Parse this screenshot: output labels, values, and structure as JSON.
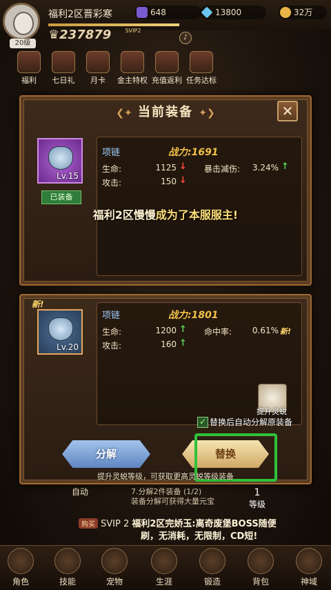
{
  "header": {
    "server_name": "福利2区晋彩寒",
    "level_badge": "20级",
    "power_value": "237879",
    "svip_label": "SVIP2",
    "currency_1": "648",
    "currency_2": "13800",
    "currency_3": "32万"
  },
  "menu": [
    "福利",
    "七日礼",
    "月卡",
    "金主特权",
    "充值返利",
    "任务达标"
  ],
  "dialog": {
    "title": "当前装备",
    "close_icon": "close-icon",
    "current": {
      "level": "Lv.15",
      "equipped_tag": "已装备",
      "name": "项链",
      "power": "战力:1691",
      "stats": [
        {
          "label": "生命:",
          "value": "1125",
          "trend": "down"
        },
        {
          "label": "攻击:",
          "value": "150",
          "trend": "down"
        }
      ],
      "extra_label": "暴击减伤:",
      "extra_value": "3.24%",
      "extra_trend": "up"
    },
    "announcement_prefix": "福利2区慢慢",
    "announcement_suffix": "成为了本服服主!",
    "candidate": {
      "new_badge": "新!",
      "level": "Lv.20",
      "name": "项链",
      "power": "战力:1801",
      "stats": [
        {
          "label": "生命:",
          "value": "1200",
          "trend": "up"
        },
        {
          "label": "攻击:",
          "value": "160",
          "trend": "up"
        }
      ],
      "extra_label": "命中率:",
      "extra_value": "0.61%",
      "extra_flag": "新!"
    },
    "upgrade_label": "提升灵蜕",
    "auto_decompose": "替换后自动分解原装备",
    "btn_decompose": "分解",
    "btn_replace": "替换",
    "hint": "提升灵蜕等级，可获取更高灵蜕等级装备"
  },
  "bottom_info": {
    "auto": "自动",
    "decompose_line1": "7.分解2件装备 (1/2)",
    "decompose_line2": "装备分解可获得大量元宝",
    "level_number": "1",
    "level_label": "等级",
    "buy_tag": "购买",
    "svip": "SVIP 2",
    "ad_line1": "福利2区完娇玉:离奇废堡BOSS随便",
    "ad_line2": "刷，无消耗，无限制，CD短!"
  },
  "nav": [
    "角色",
    "技能",
    "宠物",
    "生涯",
    "锻造",
    "背包",
    "神域"
  ]
}
